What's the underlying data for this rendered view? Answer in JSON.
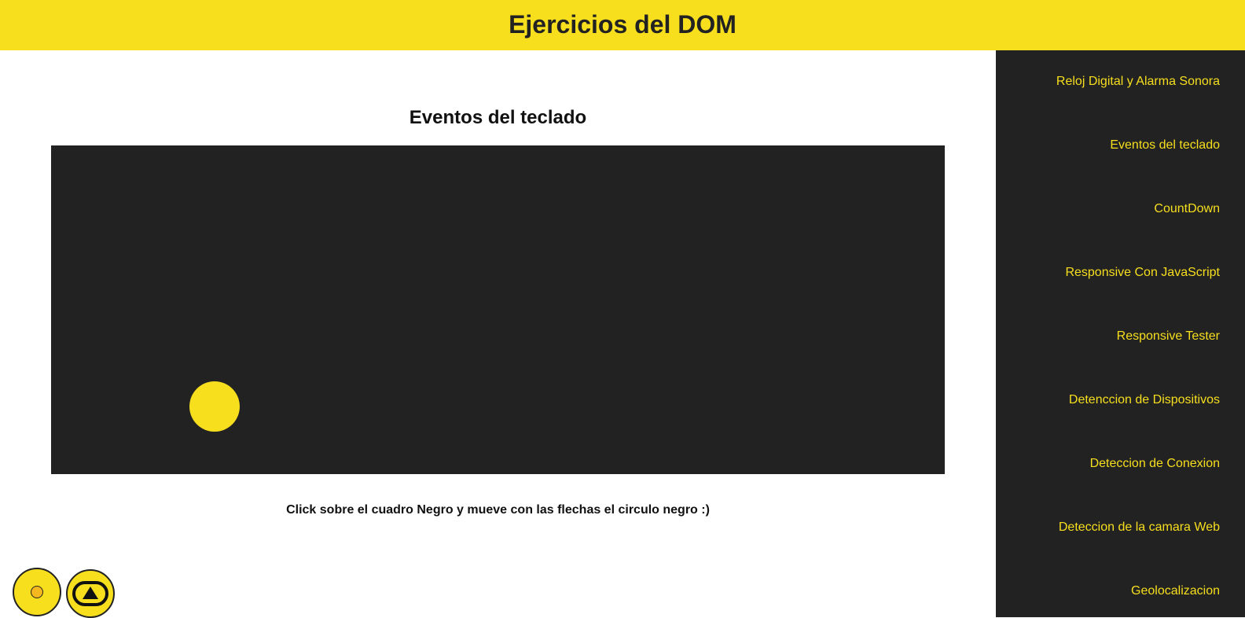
{
  "header": {
    "title": "Ejercicios del DOM"
  },
  "main": {
    "section_title": "Eventos del teclado",
    "hint": "Click sobre el cuadro Negro y mueve con las flechas el circulo negro :)"
  },
  "sidebar": {
    "items": [
      {
        "label": "Reloj Digital y Alarma Sonora"
      },
      {
        "label": "Eventos del teclado"
      },
      {
        "label": "CountDown"
      },
      {
        "label": "Responsive Con JavaScript"
      },
      {
        "label": "Responsive Tester"
      },
      {
        "label": "Detenccion de Dispositivos"
      },
      {
        "label": "Deteccion de Conexion"
      },
      {
        "label": "Deteccion de la camara Web"
      },
      {
        "label": "Geolocalizacion"
      }
    ]
  },
  "buttons": {
    "theme_icon": "sun-icon",
    "top_icon": "arrow-up-icon"
  },
  "colors": {
    "accent": "#f7df1e",
    "dark": "#222222",
    "background": "#ffffff"
  }
}
